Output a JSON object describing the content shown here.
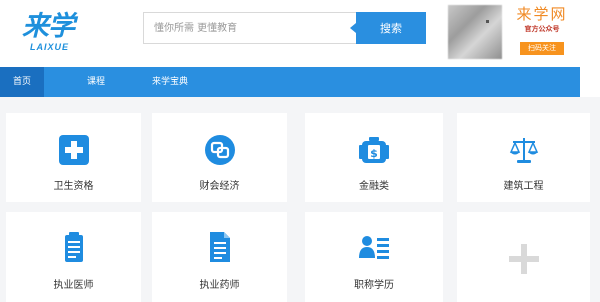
{
  "header": {
    "logo_main": "来学",
    "logo_sub": "LAIXUE",
    "search_placeholder": "懂你所需 更懂教育",
    "search_button": "搜索",
    "wechat_brand": "来学网",
    "wechat_sub": "官方公众号",
    "wechat_scan": "扫码关注"
  },
  "nav": {
    "items": [
      {
        "label": "首页",
        "active": true
      },
      {
        "label": "课程",
        "active": false
      },
      {
        "label": "来学宝典",
        "active": false
      }
    ]
  },
  "categories": [
    {
      "label": "卫生资格",
      "icon": "medical-cross-icon"
    },
    {
      "label": "财会经济",
      "icon": "coins-icon"
    },
    {
      "label": "金融类",
      "icon": "money-bag-icon"
    },
    {
      "label": "建筑工程",
      "icon": "scales-icon"
    },
    {
      "label": "执业医师",
      "icon": "clipboard-icon"
    },
    {
      "label": "执业药师",
      "icon": "document-icon"
    },
    {
      "label": "职称学历",
      "icon": "id-card-icon"
    },
    {
      "label": "",
      "icon": "add-icon"
    }
  ],
  "colors": {
    "primary": "#2a8fe0",
    "nav_active": "#1a6fc0",
    "icon_blue": "#1f8ce0",
    "brand_orange": "#f08a24",
    "page_bg": "#f4f5f7"
  }
}
